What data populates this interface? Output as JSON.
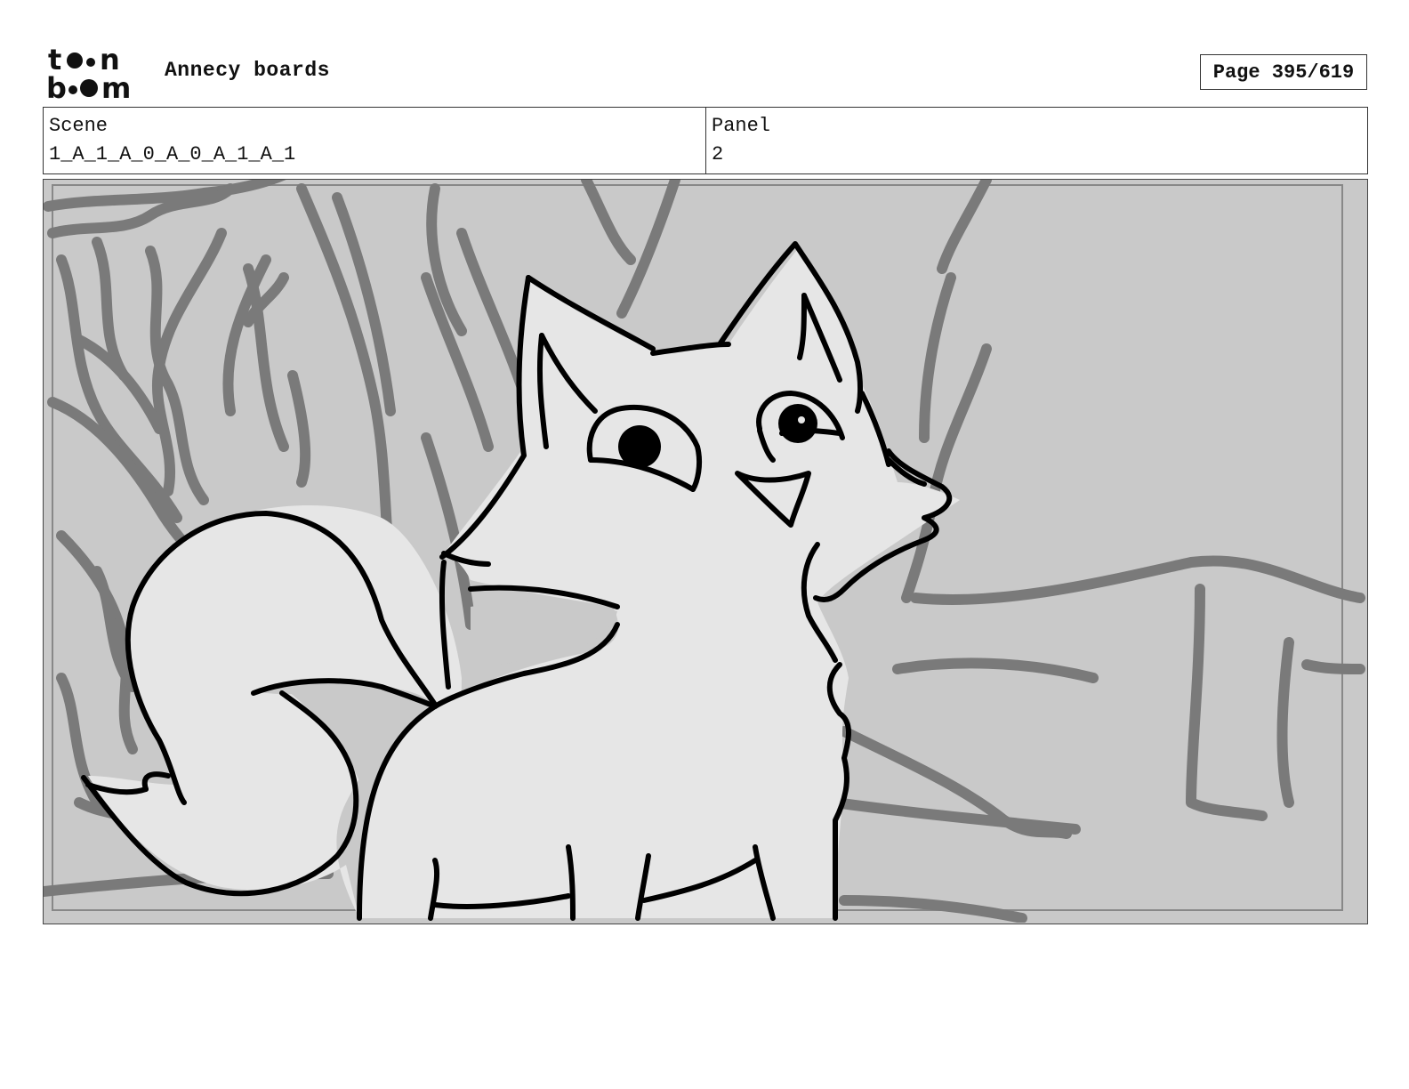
{
  "header": {
    "logo_top": "toon",
    "logo_bottom": "boom",
    "project_title": "Annecy boards",
    "page_label": "Page 395/619"
  },
  "info": {
    "scene_label": "Scene",
    "scene_value": "1_A_1_A_0_A_0_A_1_A_1",
    "panel_label": "Panel",
    "panel_value": "2"
  },
  "panel": {
    "icon": "storyboard-sketch-fox-image",
    "colors": {
      "background": "#c9c9c9",
      "sketch_lines": "#7a7a7a",
      "character_fill": "#e6e6e6",
      "ink": "#000000"
    }
  }
}
